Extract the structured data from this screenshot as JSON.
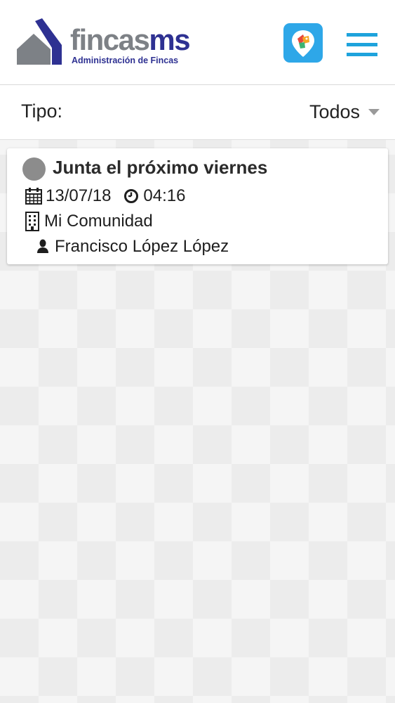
{
  "header": {
    "logo_name_part1": "fincas",
    "logo_name_part2": "ms",
    "logo_subtitle": "Administración de Fincas",
    "brand_color": "#2e3192",
    "accent_color": "#1ea3dc",
    "app_icon": "map-tags-app-icon",
    "menu_icon": "hamburger-menu-icon"
  },
  "filter": {
    "label": "Tipo:",
    "selected_value": "Todos"
  },
  "items": [
    {
      "status_color": "#8c8c8c",
      "title": "Junta el próximo viernes",
      "date": "13/07/18",
      "time": "04:16",
      "community": "Mi Comunidad",
      "person": "Francisco López López",
      "date_icon": "calendar-icon",
      "time_icon": "clock-icon",
      "community_icon": "building-icon",
      "person_icon": "user-icon"
    }
  ]
}
